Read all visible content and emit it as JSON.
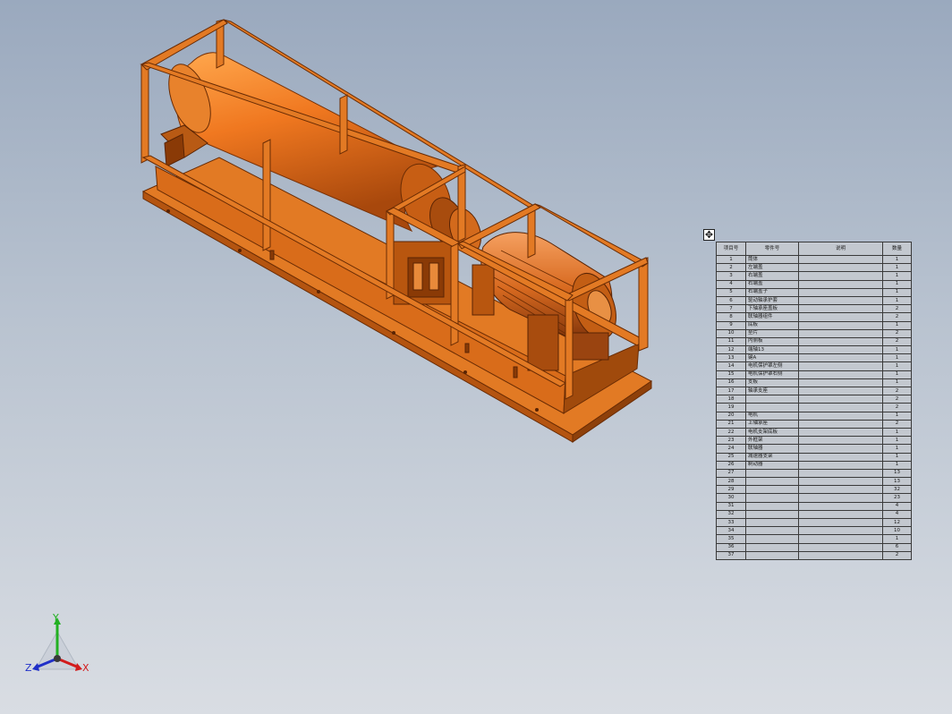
{
  "bom": {
    "anchor_symbol": "✥",
    "headers": [
      "项目号",
      "零件号",
      "说明",
      "数量"
    ],
    "rows": [
      [
        "1",
        "筒体",
        "",
        "1"
      ],
      [
        "2",
        "左端盖",
        "",
        "1"
      ],
      [
        "3",
        "右端盖",
        "",
        "1"
      ],
      [
        "4",
        "右端盖",
        "",
        "1"
      ],
      [
        "5",
        "右端盖子",
        "",
        "1"
      ],
      [
        "6",
        "驱动轴承护套",
        "",
        "1"
      ],
      [
        "7",
        "下轴承座盖板",
        "",
        "2"
      ],
      [
        "8",
        "联轴器组件",
        "",
        "2"
      ],
      [
        "9",
        "底板",
        "",
        "1"
      ],
      [
        "10",
        "垫片",
        "",
        "2"
      ],
      [
        "11",
        "内侧板",
        "",
        "2"
      ],
      [
        "12",
        "端轴13",
        "",
        "1"
      ],
      [
        "13",
        "键A",
        "",
        "1"
      ],
      [
        "14",
        "电机保护罩左侧",
        "",
        "1"
      ],
      [
        "15",
        "电机保护罩右侧",
        "",
        "1"
      ],
      [
        "16",
        "支板",
        "",
        "1"
      ],
      [
        "17",
        "轴承支座",
        "",
        "2"
      ],
      [
        "18",
        "",
        "",
        "2"
      ],
      [
        "19",
        "",
        "",
        "2"
      ],
      [
        "20",
        "电机",
        "",
        "1"
      ],
      [
        "21",
        "上轴承座",
        "",
        "2"
      ],
      [
        "22",
        "电机支架底板",
        "",
        "1"
      ],
      [
        "23",
        "外框架",
        "",
        "1"
      ],
      [
        "24",
        "联轴器",
        "",
        "1"
      ],
      [
        "25",
        "减速器支架",
        "",
        "1"
      ],
      [
        "26",
        "制动器",
        "",
        "1"
      ],
      [
        "27",
        "",
        "",
        "13"
      ],
      [
        "28",
        "",
        "",
        "13"
      ],
      [
        "29",
        "",
        "",
        "32"
      ],
      [
        "30",
        "",
        "",
        "23"
      ],
      [
        "31",
        "",
        "",
        "4"
      ],
      [
        "32",
        "",
        "",
        "4"
      ],
      [
        "33",
        "",
        "",
        "12"
      ],
      [
        "34",
        "",
        "",
        "10"
      ],
      [
        "35",
        "",
        "",
        "1"
      ],
      [
        "36",
        "",
        "",
        "6"
      ],
      [
        "37",
        "",
        "",
        "2"
      ]
    ]
  },
  "triad": {
    "x_label": "X",
    "y_label": "Y",
    "z_label": "Z"
  },
  "colors": {
    "model_orange": "#f07820",
    "model_dark": "#8a3a06",
    "model_light": "#ff9a40",
    "bg_top": "#9aa9be",
    "bg_bottom": "#d9dde3",
    "axis_x": "#d21c1c",
    "axis_y": "#22b022",
    "axis_z": "#2030c8"
  }
}
